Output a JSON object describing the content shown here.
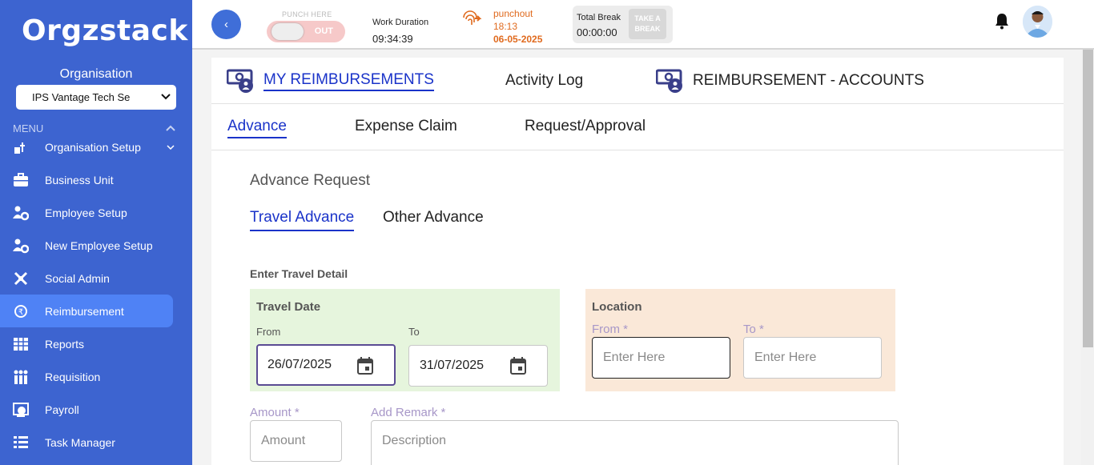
{
  "sidebar": {
    "logo": "Orgzstack",
    "org_label": "Organisation",
    "org_select_value": "IPS Vantage Tech Se",
    "menu_label": "MENU",
    "items": [
      {
        "label": "Organisation Setup",
        "icon": "org-setup-icon"
      },
      {
        "label": "Business Unit",
        "icon": "briefcase-icon"
      },
      {
        "label": "Employee Setup",
        "icon": "people-gear-icon"
      },
      {
        "label": "New Employee Setup",
        "icon": "people-gear-icon"
      },
      {
        "label": "Social Admin",
        "icon": "social-icon"
      },
      {
        "label": "Reimbursement",
        "icon": "money-icon",
        "active": true
      },
      {
        "label": "Reports",
        "icon": "grid-icon"
      },
      {
        "label": "Requisition",
        "icon": "team-icon"
      },
      {
        "label": "Payroll",
        "icon": "payroll-icon"
      },
      {
        "label": "Task Manager",
        "icon": "list-icon"
      }
    ]
  },
  "header": {
    "back_icon": "‹",
    "punch_label": "PUNCH HERE",
    "punch_state": "OUT",
    "work_duration_label": "Work Duration",
    "work_duration": "09:34:39",
    "punchout_label": "punchout",
    "punchout_time": "18:13",
    "punchout_date": "06-05-2025",
    "total_break_label": "Total Break",
    "total_break": "00:00:00",
    "take_break_line1": "TAKE A",
    "take_break_line2": "BREAK"
  },
  "tabs": {
    "main": [
      "MY REIMBURSEMENTS",
      "Activity Log",
      "REIMBURSEMENT - ACCOUNTS"
    ],
    "sub": [
      "Advance",
      "Expense Claim",
      "Request/Approval"
    ]
  },
  "advance": {
    "title": "Advance Request",
    "types": [
      "Travel Advance",
      "Other Advance"
    ],
    "section_title": "Enter Travel Detail",
    "travel_date_title": "Travel Date",
    "from_label": "From",
    "to_label": "To",
    "from_date": "26/07/2025",
    "to_date": "31/07/2025",
    "location_title": "Location",
    "loc_from_label": "From *",
    "loc_to_label": "To *",
    "loc_from_placeholder": "Enter Here",
    "loc_to_placeholder": "Enter Here",
    "amount_label": "Amount *",
    "amount_placeholder": "Amount",
    "remark_label": "Add Remark *",
    "remark_placeholder": "Description"
  },
  "colors": {
    "sidebar": "#3d64d0",
    "active_item": "#4f82f5",
    "accent": "#1a33c9",
    "punchout": "#e06a1e",
    "green_box": "#e6f5dd",
    "peach_box": "#fae8d8"
  }
}
